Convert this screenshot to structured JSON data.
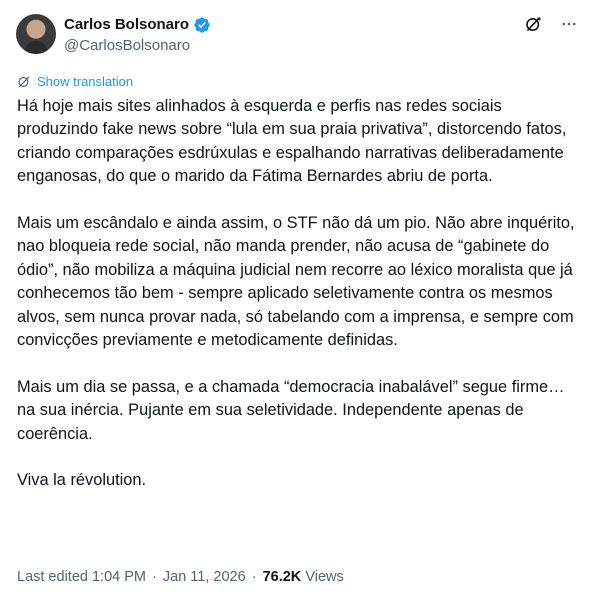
{
  "author": {
    "display_name": "Carlos Bolsonaro",
    "handle": "@CarlosBolsonaro",
    "verified": true
  },
  "actions": {
    "grok_icon": "grok-icon",
    "more_icon": "more-icon"
  },
  "translate": {
    "label": "Show translation"
  },
  "tweet": {
    "paragraphs": [
      "Há hoje mais sites alinhados à esquerda e perfis nas redes sociais produzindo fake news sobre “lula em sua praia privativa”, distorcendo fatos, criando comparações esdrúxulas e espalhando narrativas deliberadamente enganosas, do que o marido da Fátima Bernardes abriu de porta.",
      "Mais um escândalo e ainda assim, o STF não dá um pio. Não abre inquérito, nao bloqueia rede social, não manda prender, não acusa de “gabinete do ódio”, não mobiliza a máquina judicial nem recorre ao léxico moralista que já conhecemos tão bem - sempre aplicado seletivamente contra os mesmos alvos, sem nunca provar nada, só tabelando com a imprensa, e sempre com convicções previamente e metodicamente definidas.",
      "Mais um dia se passa, e a chamada “democracia inabalável” segue firme… na sua inércia. Pujante em sua seletividade. Independente apenas de coerência.",
      "Viva la révolution."
    ]
  },
  "meta": {
    "edited_prefix": "Last edited",
    "time": "1:04 PM",
    "separator": "·",
    "date": "Jan 11, 2026",
    "views_count": "76.2K",
    "views_label": "Views"
  },
  "colors": {
    "accent": "#1d9bf0",
    "secondary_text": "#536471",
    "primary_text": "#0f1419"
  }
}
